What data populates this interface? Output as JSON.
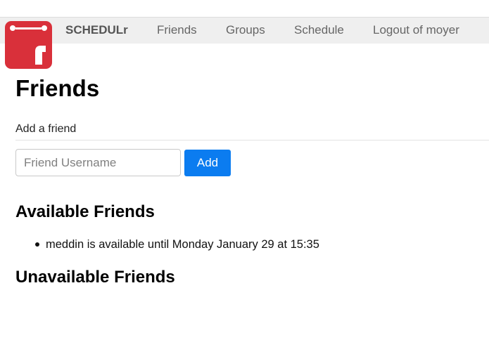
{
  "navbar": {
    "brand": "SCHEDULr",
    "links": [
      {
        "label": "Friends"
      },
      {
        "label": "Groups"
      },
      {
        "label": "Schedule"
      },
      {
        "label": "Logout of moyer"
      }
    ]
  },
  "logo": {
    "icon": "calendar-r-logo-icon",
    "color": "#d9303a"
  },
  "main": {
    "title": "Friends",
    "add_section_label": "Add a friend",
    "input_placeholder": "Friend Username",
    "add_button_label": "Add",
    "available_heading": "Available Friends",
    "available_friends": [
      "meddin is available until Monday January 29 at 15:35"
    ],
    "unavailable_heading": "Unavailable Friends"
  },
  "colors": {
    "accent": "#0b7cf0",
    "navbar_bg": "#efefef"
  }
}
